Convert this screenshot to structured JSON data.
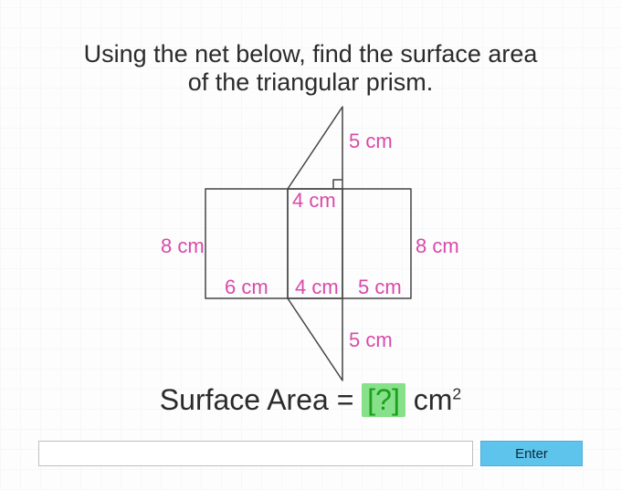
{
  "prompt_line1": "Using the net below, find the surface area",
  "prompt_line2": "of the triangular prism.",
  "labels": {
    "left8": "8 cm",
    "right8": "8 cm",
    "bot6": "6 cm",
    "bot4": "4 cm",
    "bot5": "5 cm",
    "mid4": "4 cm",
    "top5": "5 cm",
    "low5": "5 cm"
  },
  "equation": {
    "lhs": "Surface Area  =",
    "answer_placeholder": "[?]",
    "units": "cm",
    "exp": "2"
  },
  "enter_label": "Enter",
  "chart_data": {
    "type": "diagram",
    "shape": "triangular-prism-net",
    "rectangles": [
      {
        "width_cm": 6,
        "height_cm": 8
      },
      {
        "width_cm": 4,
        "height_cm": 8
      },
      {
        "width_cm": 5,
        "height_cm": 8
      }
    ],
    "triangles": [
      {
        "base_cm": 4,
        "height_cm": 6,
        "hypotenuse_cm": 5,
        "note": "right triangle adjoining top edge of 4 cm rectangle, right angle at top-right"
      },
      {
        "base_cm": 4,
        "height_cm": 6,
        "hypotenuse_cm": 5,
        "note": "right triangle adjoining bottom edge of 4 cm rectangle"
      }
    ],
    "question": "surface area of the triangular prism",
    "answer_units": "cm^2"
  }
}
